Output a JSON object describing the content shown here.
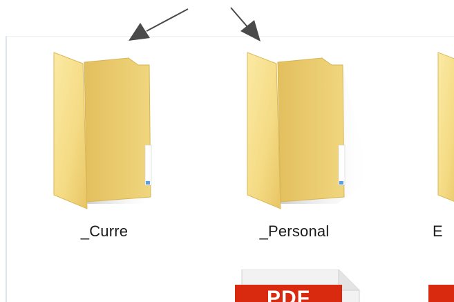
{
  "folders": [
    {
      "name": "_Curre",
      "icon": "folder-icon"
    },
    {
      "name": "_Personal",
      "icon": "folder-icon"
    },
    {
      "name": "E",
      "icon": "folder-icon"
    }
  ],
  "files": [
    {
      "type_badge": "PDF",
      "icon": "pdf-file-icon"
    },
    {
      "type_badge": "",
      "icon": "pdf-file-icon"
    }
  ],
  "annotations": {
    "arrow_color": "#4a4a4a"
  },
  "colors": {
    "folder_front": "#f6df8a",
    "folder_back": "#e9c766",
    "pdf_red": "#d9290f"
  }
}
